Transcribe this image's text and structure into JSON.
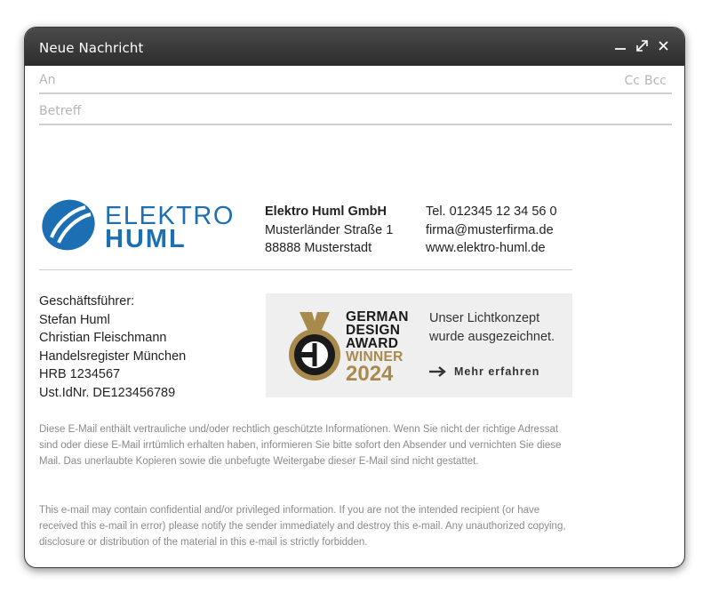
{
  "window": {
    "title": "Neue Nachricht"
  },
  "compose": {
    "to_placeholder": "An",
    "cc_label": "Cc",
    "bcc_label": "Bcc",
    "subject_placeholder": "Betreff"
  },
  "signature": {
    "logo": {
      "line1": "ELEKTRO",
      "line2": "HUML"
    },
    "company": {
      "name": "Elektro Huml GmbH",
      "street": "Musterländer Straße 1",
      "city": "88888 Musterstadt"
    },
    "contact": {
      "phone": "Tel. 012345 12 34 56 0",
      "email": "firma@musterfirma.de",
      "web": "www.elektro-huml.de"
    },
    "management": {
      "label": "Geschäftsführer:",
      "person1": "Stefan Huml",
      "person2": "Christian Fleischmann",
      "register": "Handelsregister München",
      "hrb": "HRB 1234567",
      "vat": "Ust.IdNr. DE123456789"
    },
    "award": {
      "line1": "GERMAN",
      "line2": "DESIGN",
      "line3": "AWARD",
      "line4": "WINNER",
      "year": "2024",
      "text1": "Unser Lichtkonzept",
      "text2": "wurde ausgezeichnet.",
      "link_label": "Mehr erfahren"
    }
  },
  "disclaimer": {
    "german": "Diese E-Mail enthält vertrauliche und/oder rechtlich geschützte Informationen. Wenn Sie nicht der richtige Adressat sind oder diese E-Mail irrtümlich erhalten haben, informieren Sie bitte sofort den Absender und vernichten Sie diese Mail. Das unerlaubte Kopieren sowie die unbefugte Weitergabe dieser E-Mail sind nicht gestattet.",
    "english": "This e-mail may contain confidential and/or privileged information. If you are not the intended recipient (or have received this e-mail in error) please notify the sender immediately and destroy this e-mail. Any unauthorized copying, disclosure or distribution of the material in this e-mail is strictly forbidden."
  },
  "colors": {
    "brand_blue": "#1d6fb3",
    "award_gold": "#a98a4d",
    "titlebar": "#3a3a3a"
  }
}
